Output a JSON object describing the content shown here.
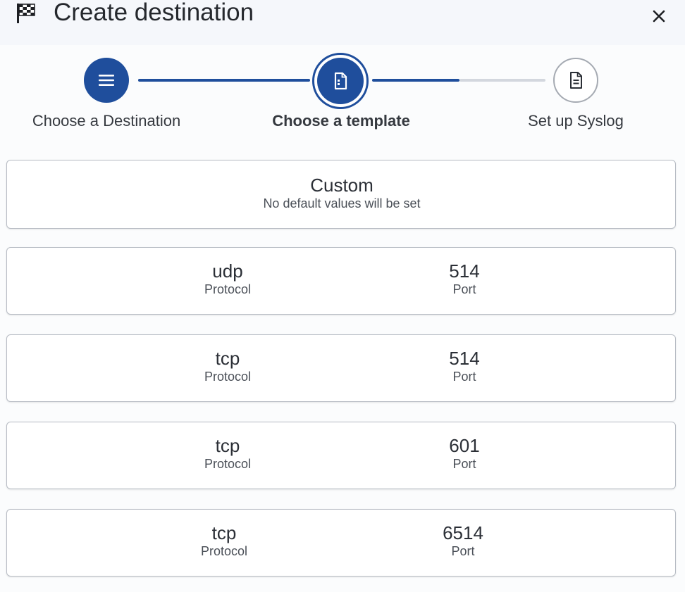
{
  "header": {
    "title": "Create destination"
  },
  "stepper": {
    "steps": [
      {
        "label": "Choose a Destination",
        "state": "completed",
        "icon": "menu-icon"
      },
      {
        "label": "Choose a template",
        "state": "active",
        "icon": "template-icon"
      },
      {
        "label": "Set up Syslog",
        "state": "pending",
        "icon": "document-icon"
      }
    ]
  },
  "templates": {
    "custom": {
      "title": "Custom",
      "subtitle": "No default values will be set"
    },
    "options": [
      {
        "protocol": "udp",
        "protocol_label": "Protocol",
        "port": "514",
        "port_label": "Port"
      },
      {
        "protocol": "tcp",
        "protocol_label": "Protocol",
        "port": "514",
        "port_label": "Port"
      },
      {
        "protocol": "tcp",
        "protocol_label": "Protocol",
        "port": "601",
        "port_label": "Port"
      },
      {
        "protocol": "tcp",
        "protocol_label": "Protocol",
        "port": "6514",
        "port_label": "Port"
      }
    ]
  },
  "colors": {
    "accent": "#1f4e9c",
    "pending": "#d3d7de",
    "pending_border": "#a5aab2"
  }
}
